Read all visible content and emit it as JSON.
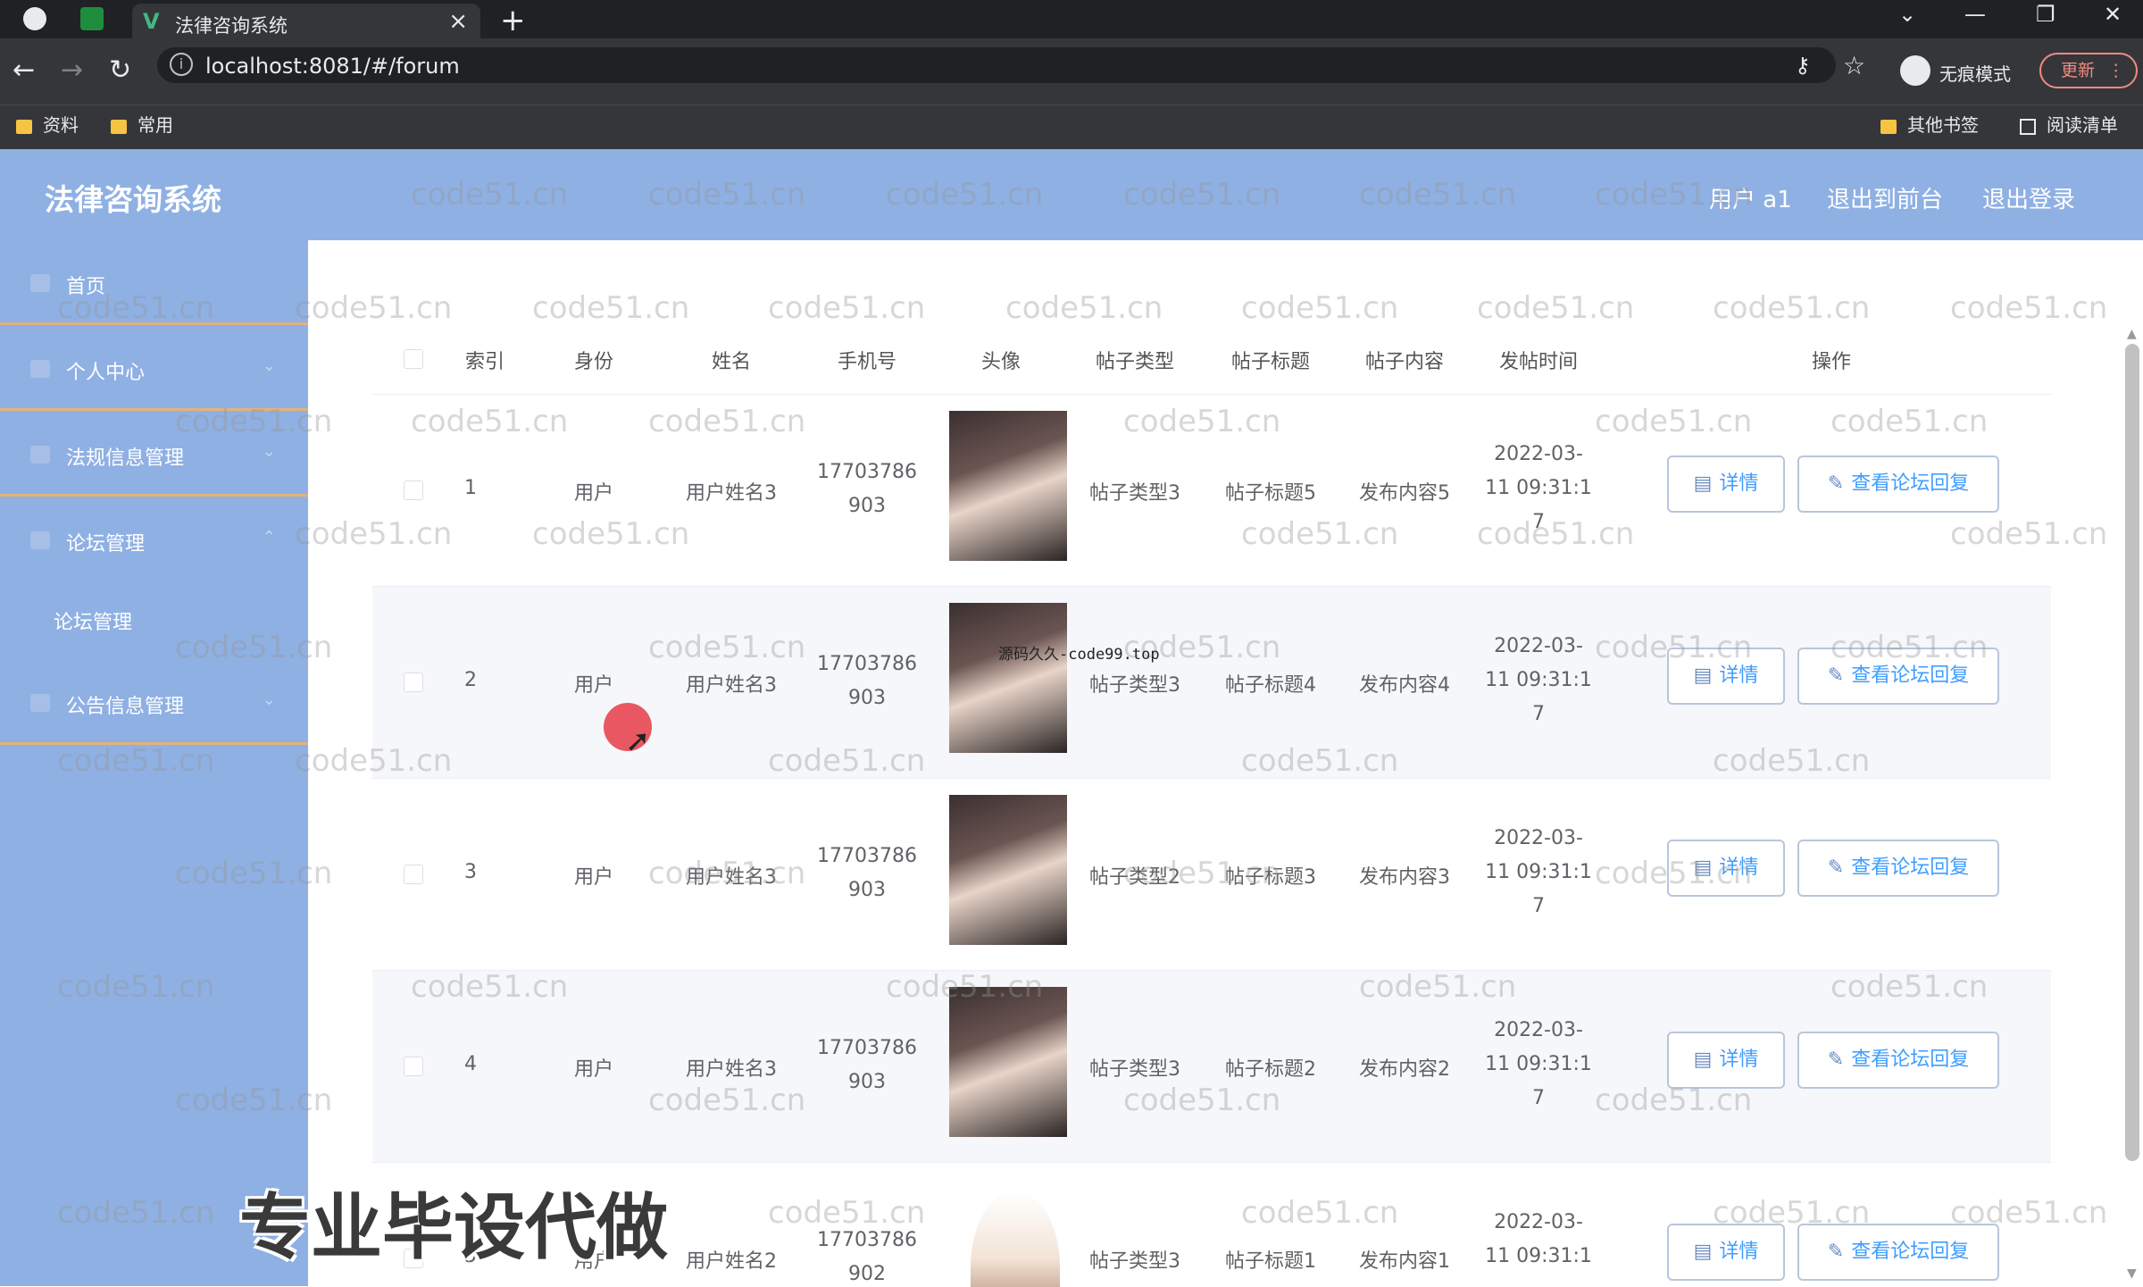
{
  "browser": {
    "tab_title": "法律咨询系统",
    "url": "localhost:8081/#/forum",
    "profile_label": "无痕模式",
    "update_label": "更新",
    "bookmarks": [
      "资料",
      "常用"
    ],
    "bookmarks_right": [
      "其他书签",
      "阅读清单"
    ]
  },
  "header": {
    "app_title": "法律咨询系统",
    "user": "用户 a1",
    "exit_front": "退出到前台",
    "logout": "退出登录"
  },
  "sidebar": {
    "items": [
      {
        "label": "首页",
        "icon": "home-icon"
      },
      {
        "label": "个人中心",
        "icon": "user-icon"
      },
      {
        "label": "法规信息管理",
        "icon": "doc-icon"
      },
      {
        "label": "论坛管理",
        "icon": "forum-icon"
      },
      {
        "label": "公告信息管理",
        "icon": "notice-icon"
      }
    ],
    "submenu": "论坛管理"
  },
  "table": {
    "columns": [
      "索引",
      "身份",
      "姓名",
      "手机号",
      "头像",
      "帖子类型",
      "帖子标题",
      "帖子内容",
      "发帖时间",
      "操作"
    ],
    "rows": [
      {
        "index": "1",
        "identity": "用户",
        "name": "用户姓名3",
        "phone1": "17703786",
        "phone2": "903",
        "type": "帖子类型3",
        "title": "帖子标题5",
        "content": "发布内容5",
        "time1": "2022-03-",
        "time2": "11 09:31:1",
        "time3": "7"
      },
      {
        "index": "2",
        "identity": "用户",
        "name": "用户姓名3",
        "phone1": "17703786",
        "phone2": "903",
        "type": "帖子类型3",
        "title": "帖子标题4",
        "content": "发布内容4",
        "time1": "2022-03-",
        "time2": "11 09:31:1",
        "time3": "7"
      },
      {
        "index": "3",
        "identity": "用户",
        "name": "用户姓名3",
        "phone1": "17703786",
        "phone2": "903",
        "type": "帖子类型2",
        "title": "帖子标题3",
        "content": "发布内容3",
        "time1": "2022-03-",
        "time2": "11 09:31:1",
        "time3": "7"
      },
      {
        "index": "4",
        "identity": "用户",
        "name": "用户姓名3",
        "phone1": "17703786",
        "phone2": "903",
        "type": "帖子类型3",
        "title": "帖子标题2",
        "content": "发布内容2",
        "time1": "2022-03-",
        "time2": "11 09:31:1",
        "time3": "7"
      },
      {
        "index": "5",
        "identity": "用户",
        "name": "用户姓名2",
        "phone1": "17703786",
        "phone2": "902",
        "type": "帖子类型3",
        "title": "帖子标题1",
        "content": "发布内容1",
        "time1": "2022-03-",
        "time2": "11 09:31:1",
        "time3": ""
      }
    ],
    "detail_label": "详情",
    "reply_label": "查看论坛回复"
  },
  "overlay": {
    "watermark": "code51.cn",
    "big_text": "专业毕设代做",
    "small_text": "源码久久-code99.top"
  },
  "colors": {
    "header_bg": "#8fb0e3",
    "sidebar_bg": "#8fb0e3",
    "link": "#409eff",
    "divider": "#e3b27a"
  }
}
